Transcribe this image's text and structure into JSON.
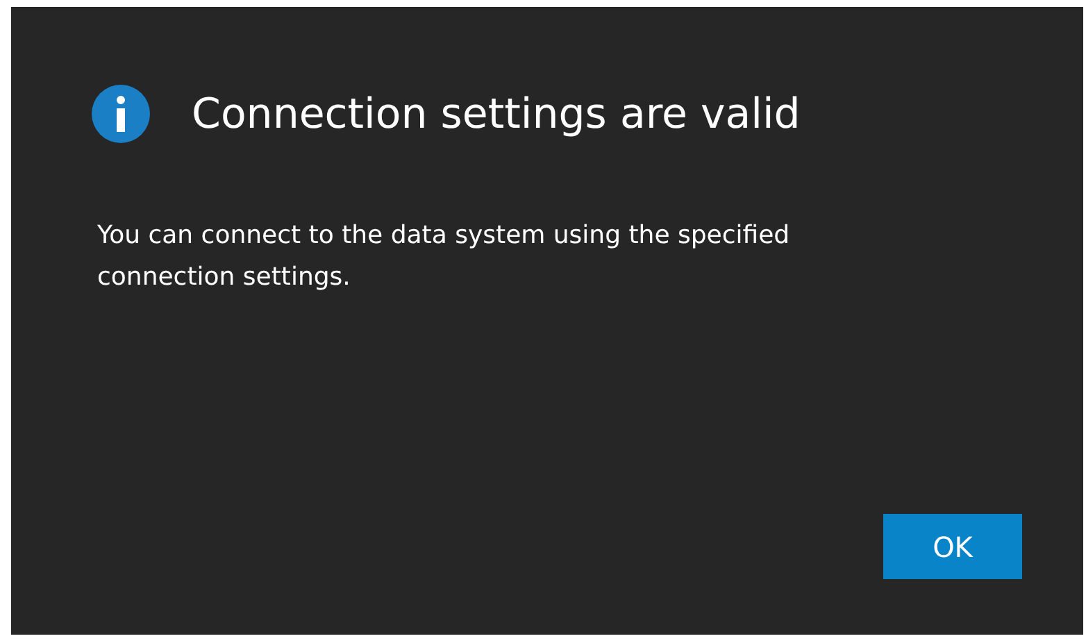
{
  "dialog": {
    "title": "Connection settings are valid",
    "message": "You can connect to the data system using the specified connection settings.",
    "buttons": [
      {
        "label": "OK"
      }
    ]
  }
}
